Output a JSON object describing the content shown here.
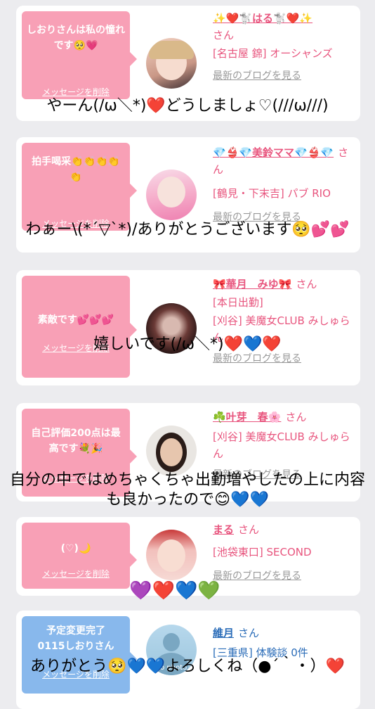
{
  "cards": [
    {
      "message": "しおりさんは私の憧れです🥺💗",
      "delete_label": "メッセージを削除",
      "name": "✨❤️🐩はる🐩❤️✨",
      "honorific": "さん",
      "shop": "[名古屋 錦] オーシャンズ",
      "blog": "最新のブログを見る",
      "overlay": "やーん(/ω＼*)❤️どうしましょ♡(///ω///)"
    },
    {
      "message": "拍手喝采👏👏👏👏👏",
      "delete_label": "メッセージを削除",
      "name": "💎👙💎美鈴ママ💎👙💎",
      "honorific": "さん",
      "shop": "[鶴見・下末吉] パブ RIO",
      "blog": "最新のブログを見る",
      "overlay": "わぁー\\(*´▽`*)/ありがとうございます🥺💕💕"
    },
    {
      "message": "素敵です💕💕💕",
      "delete_label": "メッセージを削除",
      "name": "🎀華月　みゆ🎀",
      "honorific": "さん",
      "shop_line1": "[本日出勤]",
      "shop": "[刈谷] 美魔女CLUB みしゅらん",
      "blog": "最新のブログを見る",
      "overlay": "嬉しいです(/ω＼*)❤️💙❤️"
    },
    {
      "message": "自己評価200点は最高です💐🎉",
      "delete_label": "メッセージを削除",
      "name": "☘️叶芽　春🌸",
      "honorific": "さん",
      "shop": "[刈谷] 美魔女CLUB みしゅらん",
      "blog": "最新のブログを見る",
      "overlay": "自分の中ではめちゃくちゃ出勤増やしたの上に内容も良かったので😊💙💙"
    },
    {
      "message": "(♡)🌙",
      "delete_label": "メッセージを削除",
      "name": "まる",
      "honorific": "さん",
      "shop": "[池袋東口] SECOND",
      "blog": "最新のブログを見る",
      "overlay": "💜❤️💙💚"
    },
    {
      "message": "予定変更完了0115しおりさん",
      "delete_label": "メッセージを削除",
      "name": "維月",
      "honorific": "さん",
      "shop": "[三重県] 体験談 0件",
      "avatar_text": "no photo",
      "overlay": "ありがとう🥺💙💙よろしくね（●´｀・）❤️"
    }
  ],
  "colors": {
    "pink_bubble": "#f8a0b6",
    "blue_bubble": "#88b8ec",
    "accent": "#e8557e",
    "link_blue": "#2a6cb8"
  }
}
